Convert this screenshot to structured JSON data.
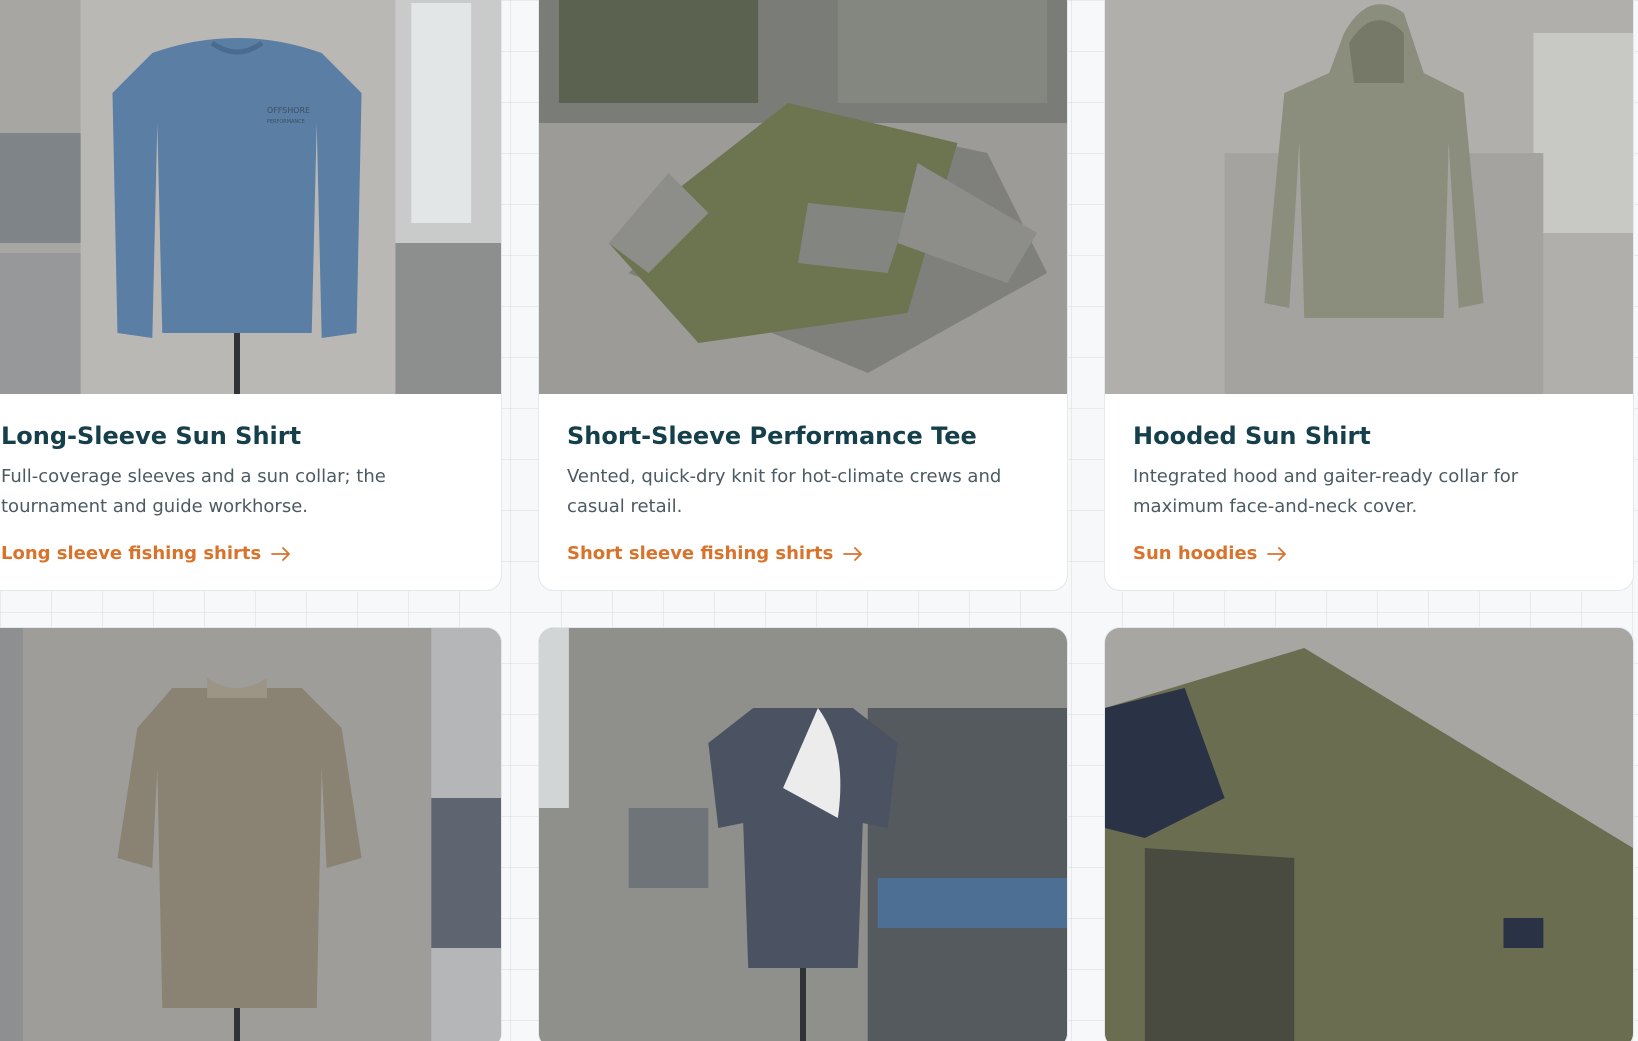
{
  "cards": [
    {
      "title": "Long-Sleeve Sun Shirt",
      "description": "Full-coverage sleeves and a sun collar; the tournament and guide workhorse.",
      "link_label": "Long sleeve fishing shirts",
      "image_text": "OFFSHORE",
      "image_subtext": "PERFORMANCE"
    },
    {
      "title": "Short-Sleeve Performance Tee",
      "description": "Vented, quick-dry knit for hot-climate crews and casual retail.",
      "link_label": "Short sleeve fishing shirts"
    },
    {
      "title": "Hooded Sun Shirt",
      "description": "Integrated hood and gaiter-ready collar for maximum face-and-neck cover.",
      "link_label": "Sun hoodies"
    },
    {},
    {},
    {}
  ],
  "colors": {
    "title": "#153f4a",
    "body_text": "#4c5a61",
    "link": "#d9732c",
    "page_background": "#f6f8f9"
  },
  "icons": [
    "arrow-right-icon"
  ]
}
